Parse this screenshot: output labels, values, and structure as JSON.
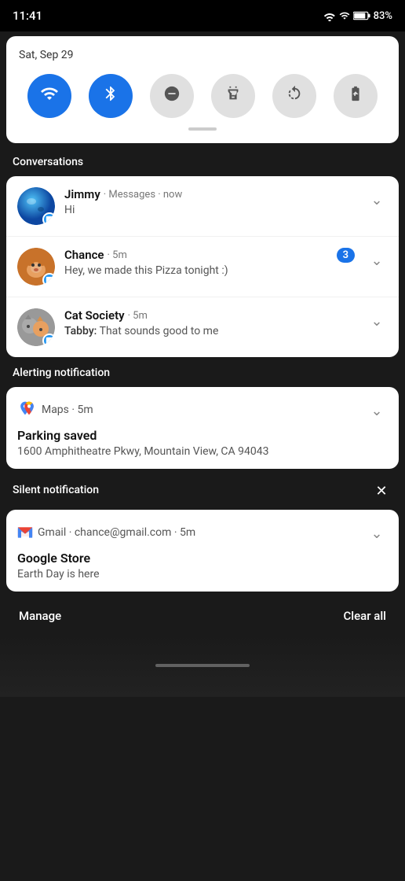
{
  "statusBar": {
    "time": "11:41",
    "battery": "83%"
  },
  "quickSettings": {
    "date": "Sat, Sep 29",
    "toggles": [
      {
        "id": "wifi",
        "active": true,
        "icon": "wifi"
      },
      {
        "id": "bluetooth",
        "active": true,
        "icon": "bluetooth"
      },
      {
        "id": "dnd",
        "active": false,
        "icon": "minus"
      },
      {
        "id": "flashlight",
        "active": false,
        "icon": "flashlight"
      },
      {
        "id": "rotate",
        "active": false,
        "icon": "rotate"
      },
      {
        "id": "battery",
        "active": false,
        "icon": "battery"
      }
    ]
  },
  "sections": {
    "conversations": "Conversations",
    "alerting": "Alerting notification",
    "silent": "Silent notification"
  },
  "conversations": [
    {
      "name": "Jimmy",
      "app": "Messages",
      "time": "now",
      "message": "Hi",
      "badge": null,
      "avatarColor": "#2196F3"
    },
    {
      "name": "Chance",
      "app": "",
      "time": "5m",
      "message": "Hey, we made this Pizza tonight :)",
      "badge": "3",
      "avatarColor": "#d2691e"
    },
    {
      "name": "Cat Society",
      "app": "",
      "time": "5m",
      "messageSender": "Tabby",
      "message": "That sounds good to me",
      "badge": null,
      "avatarColor": "#888"
    }
  ],
  "alertingNotif": {
    "app": "Maps",
    "time": "5m",
    "title": "Parking saved",
    "body": "1600 Amphitheatre Pkwy, Mountain View, CA 94043"
  },
  "silentNotif": {
    "app": "Gmail",
    "email": "chance@gmail.com",
    "time": "5m",
    "title": "Google Store",
    "body": "Earth Day is here"
  },
  "bottomBar": {
    "manage": "Manage",
    "clearAll": "Clear all"
  }
}
